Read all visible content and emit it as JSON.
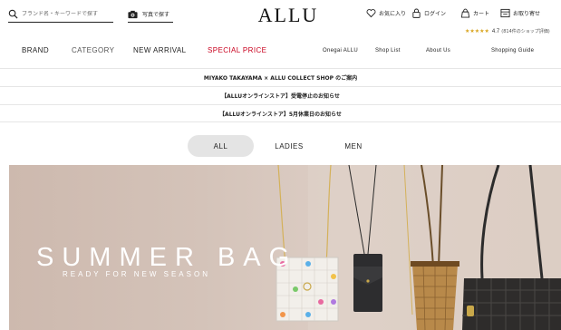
{
  "header": {
    "search_placeholder": "ブランド名・キーワードで探す",
    "photo_search_label": "写真で探す",
    "logo": "ALLU",
    "utilities": {
      "favorites": "お気に入り",
      "login": "ログイン",
      "cart": "カート",
      "contact": "お取り寄せ"
    },
    "rating": {
      "stars": "★★★★★",
      "score": "4.7",
      "count": "(814件のショップ評価)"
    }
  },
  "nav": {
    "main": [
      "BRAND",
      "CATEGORY",
      "NEW ARRIVAL",
      "SPECIAL PRICE"
    ],
    "sub": [
      "Onegai ALLU",
      "Shop List",
      "About Us",
      "Shopping Guide"
    ]
  },
  "notices": [
    "MIYAKO TAKAYAMA × ALLU COLLECT SHOP のご案内",
    "【ALLUオンラインストア】受電停止のお知らせ",
    "【ALLUオンラインストア】5月休業日のお知らせ"
  ],
  "tabs": [
    {
      "label": "ALL",
      "active": true
    },
    {
      "label": "LADIES",
      "active": false
    },
    {
      "label": "MEN",
      "active": false
    }
  ],
  "hero": {
    "title": "SUMMER BAG",
    "subtitle": "READY FOR NEW SEASON"
  },
  "colors": {
    "accent_special": "#c9001e",
    "star": "#d9a520",
    "tab_active_bg": "#e4e4e4"
  },
  "icons": [
    "search-icon",
    "camera-icon",
    "heart-icon",
    "lock-icon",
    "cart-icon",
    "request-icon"
  ]
}
